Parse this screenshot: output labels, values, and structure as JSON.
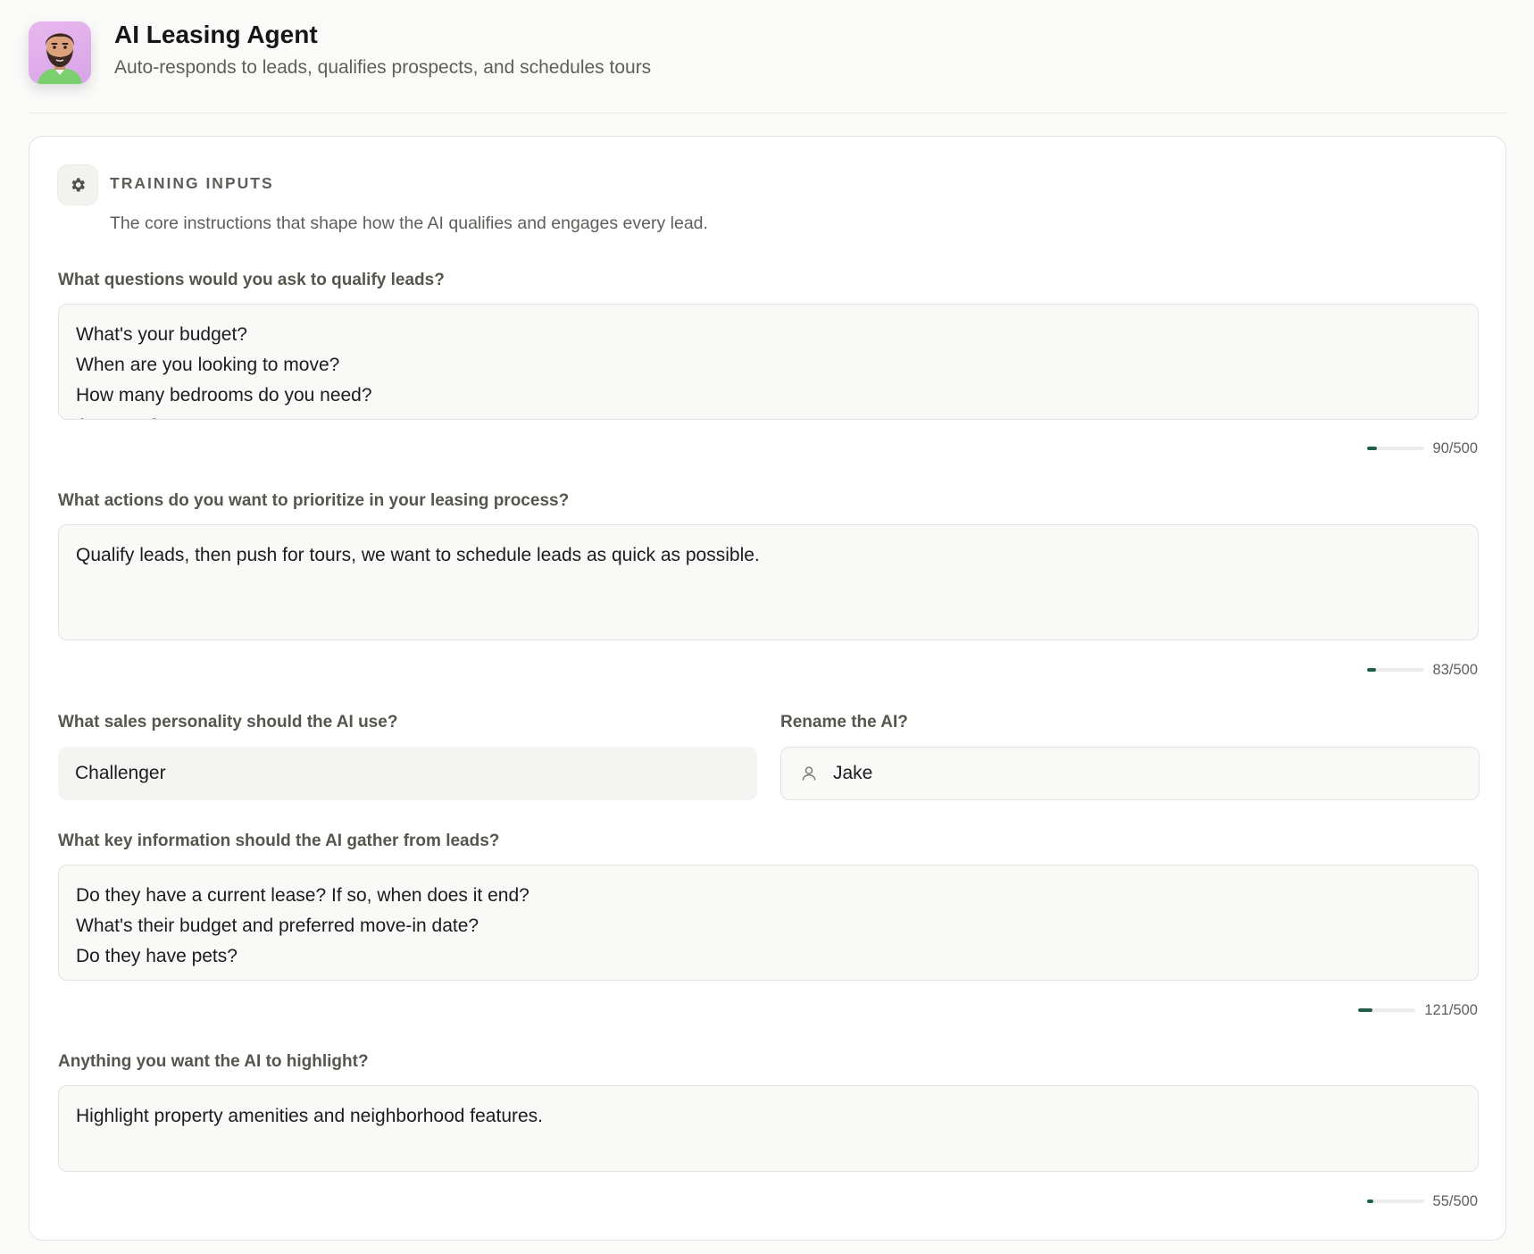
{
  "header": {
    "title": "AI Leasing Agent",
    "subtitle": "Auto-responds to leads, qualifies prospects, and schedules tours",
    "avatar_icon": "bearded-man-avatar"
  },
  "colors": {
    "accent": "#1f5f4c",
    "avatar_bg": "#dcaae8"
  },
  "section": {
    "icon": "gear-icon",
    "title": "TRAINING INPUTS",
    "description": "The core instructions that shape how the AI qualifies and engages every lead."
  },
  "fields": {
    "qualify": {
      "label": "What questions would you ask to qualify leads?",
      "lines": [
        "What's your budget?",
        "When are you looking to move?",
        "How many bedrooms do you need?",
        "Any pets?"
      ],
      "counter": "90/500",
      "progress": 0.18
    },
    "actions": {
      "label": "What actions do you want to prioritize in your leasing process?",
      "lines": [
        "Qualify leads, then push for tours, we want to schedule leads as quick as possible."
      ],
      "counter": "83/500",
      "progress": 0.166
    },
    "personality": {
      "label": "What sales personality should the AI use?",
      "value": "Challenger"
    },
    "rename": {
      "label": "Rename the AI?",
      "value": "Jake",
      "icon": "user-icon"
    },
    "key_info": {
      "label": "What key information should the AI gather from leads?",
      "lines": [
        "Do they have a current lease? If so, when does it end?",
        "What's their budget and preferred move-in date?",
        "Do they have pets?"
      ],
      "counter": "121/500",
      "progress": 0.242
    },
    "highlight": {
      "label": "Anything you want the AI to highlight?",
      "lines": [
        "Highlight property amenities and neighborhood features."
      ],
      "counter": "55/500",
      "progress": 0.11
    }
  }
}
